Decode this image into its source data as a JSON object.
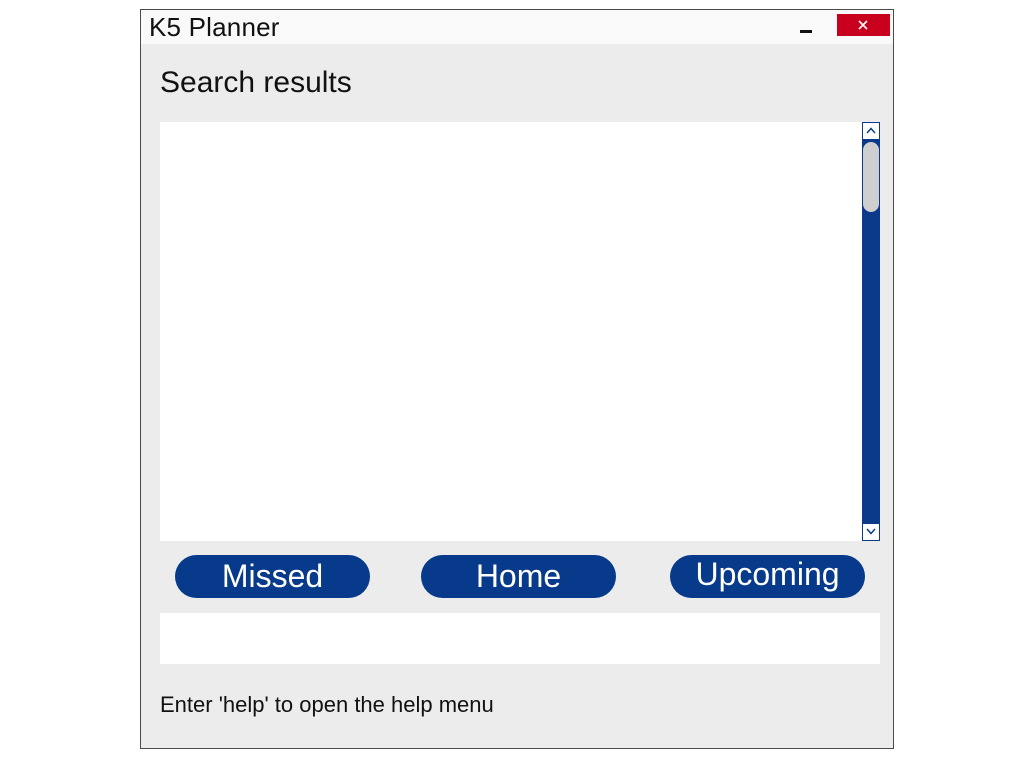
{
  "window": {
    "title": "K5 Planner",
    "minimize_icon": "minimize-icon",
    "close_icon": "close-icon",
    "close_color": "#c8001e"
  },
  "main": {
    "heading": "Search results",
    "results": [],
    "scrollbar_color": "#0b3a8a"
  },
  "nav": {
    "missed_label": "Missed",
    "home_label": "Home",
    "upcoming_label": "Upcoming",
    "button_color": "#073a8a"
  },
  "command": {
    "value": "",
    "hint": "Enter 'help' to open the help menu"
  }
}
